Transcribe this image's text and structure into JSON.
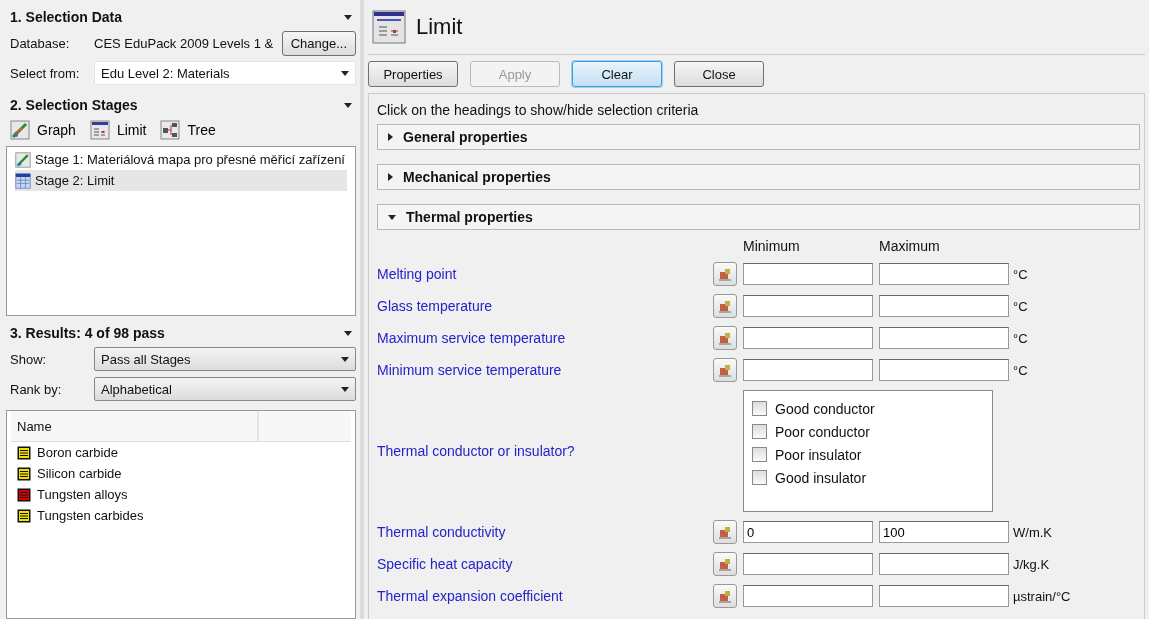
{
  "selection_data": {
    "title": "1. Selection Data",
    "database_label": "Database:",
    "database": "CES EduPack 2009 Levels 1 &",
    "change_button": "Change...",
    "select_from_label": "Select from:",
    "select_from": "Edu Level 2: Materials"
  },
  "selection_stages": {
    "title": "2. Selection Stages",
    "tools": [
      {
        "kind": "graph",
        "label": "Graph"
      },
      {
        "kind": "limit",
        "label": "Limit"
      },
      {
        "kind": "tree",
        "label": "Tree"
      }
    ],
    "stages": [
      {
        "kind": "graph",
        "label": "Stage 1: Materiálová mapa pro přesné měřicí zařízení",
        "selected": false
      },
      {
        "kind": "limit",
        "label": "Stage 2: Limit",
        "selected": true
      }
    ]
  },
  "results": {
    "title": "3. Results: 4 of 98 pass",
    "show_label": "Show:",
    "show": "Pass all Stages",
    "rank_label": "Rank by:",
    "rank": "Alphabetical",
    "column": "Name",
    "items": [
      {
        "name": "Boron carbide",
        "color": "#f0e000"
      },
      {
        "name": "Silicon carbide",
        "color": "#f0e000"
      },
      {
        "name": "Tungsten alloys",
        "color": "#e00000"
      },
      {
        "name": "Tungsten carbides",
        "color": "#f0e000"
      }
    ]
  },
  "limit": {
    "title": "Limit",
    "buttons": [
      {
        "label": "Properties",
        "disabled": false,
        "selected": false
      },
      {
        "label": "Apply",
        "disabled": true,
        "selected": false
      },
      {
        "label": "Clear",
        "disabled": false,
        "selected": true
      },
      {
        "label": "Close",
        "disabled": false,
        "selected": false
      }
    ],
    "hint": "Click on the headings to show/hide selection criteria",
    "sections": [
      {
        "label": "General properties",
        "expanded": false
      },
      {
        "label": "Mechanical properties",
        "expanded": false
      },
      {
        "label": "Thermal properties",
        "expanded": true
      }
    ],
    "min_heading": "Minimum",
    "max_heading": "Maximum",
    "criteria": [
      {
        "kind": "range",
        "label": "Melting point",
        "unit": "°C"
      },
      {
        "kind": "range",
        "label": "Glass temperature",
        "unit": "°C"
      },
      {
        "kind": "range",
        "label": "Maximum service temperature",
        "unit": "°C"
      },
      {
        "kind": "range",
        "label": "Minimum service temperature",
        "unit": "°C"
      },
      {
        "kind": "checklist",
        "label": "Thermal conductor or insulator?",
        "options": [
          {
            "label": "Good conductor",
            "checked": false
          },
          {
            "label": "Poor conductor",
            "checked": false
          },
          {
            "label": "Poor insulator",
            "checked": false
          },
          {
            "label": "Good insulator",
            "checked": false
          }
        ]
      },
      {
        "kind": "range",
        "label": "Thermal conductivity",
        "min": "0",
        "max": "100",
        "unit": "W/m.K"
      },
      {
        "kind": "range",
        "label": "Specific heat capacity",
        "unit": "J/kg.K"
      },
      {
        "kind": "range",
        "label": "Thermal expansion coefficient",
        "unit": "µstrain/°C"
      }
    ]
  }
}
